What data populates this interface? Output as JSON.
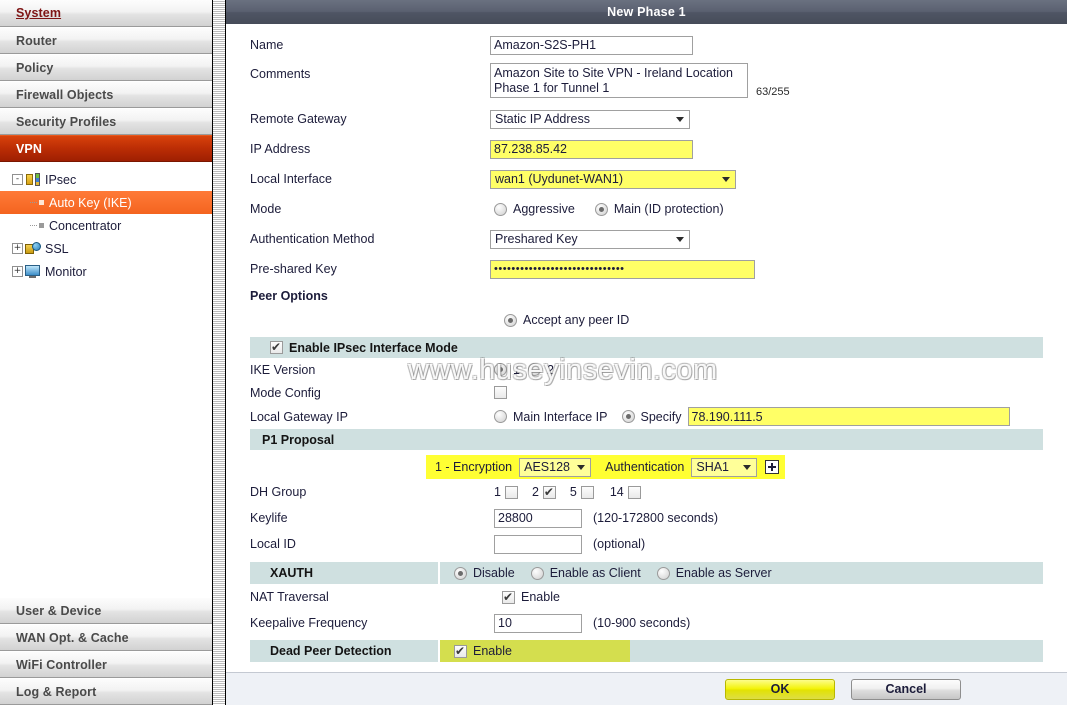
{
  "sidebar": {
    "top_menu": [
      {
        "label": "System",
        "active": false,
        "link": true
      },
      {
        "label": "Router",
        "active": false
      },
      {
        "label": "Policy",
        "active": false
      },
      {
        "label": "Firewall Objects",
        "active": false
      },
      {
        "label": "Security Profiles",
        "active": false
      },
      {
        "label": "VPN",
        "active": true
      }
    ],
    "tree": [
      {
        "label": "IPsec",
        "icon": "ipsec-icon",
        "expander": "-",
        "level": 0,
        "selected": false
      },
      {
        "label": "Auto Key (IKE)",
        "icon": "leaf-icon",
        "level": 1,
        "selected": true
      },
      {
        "label": "Concentrator",
        "icon": "leaf-icon",
        "level": 1,
        "selected": false
      },
      {
        "label": "SSL",
        "icon": "ssl-icon",
        "expander": "+",
        "level": 0,
        "selected": false
      },
      {
        "label": "Monitor",
        "icon": "monitor-icon",
        "expander": "+",
        "level": 0,
        "selected": false
      }
    ],
    "bottom_menu": [
      {
        "label": "User & Device"
      },
      {
        "label": "WAN Opt. & Cache"
      },
      {
        "label": "WiFi Controller"
      },
      {
        "label": "Log & Report"
      }
    ]
  },
  "dialog": {
    "title": "New Phase 1",
    "watermark": "www.huseyinsevin.com",
    "fields": {
      "name_label": "Name",
      "name_value": "Amazon-S2S-PH1",
      "comments_label": "Comments",
      "comments_value": "Amazon Site to Site VPN - Ireland Location Phase 1 for Tunnel 1",
      "comments_counter": "63/255",
      "remote_gateway_label": "Remote Gateway",
      "remote_gateway_value": "Static IP Address",
      "ip_address_label": "IP Address",
      "ip_address_value": "87.238.85.42",
      "local_interface_label": "Local Interface",
      "local_interface_value": "wan1 (Uydunet-WAN1)",
      "mode_label": "Mode",
      "mode_aggressive": "Aggressive",
      "mode_main": "Main (ID protection)",
      "auth_method_label": "Authentication Method",
      "auth_method_value": "Preshared Key",
      "psk_label": "Pre-shared Key",
      "psk_value": "••••••••••••••••••••••••••••••",
      "peer_options_label": "Peer Options",
      "accept_any_peer_id": "Accept any peer ID",
      "enable_ipsec_interface_mode": "Enable IPsec Interface Mode",
      "ike_version_label": "IKE Version",
      "ike_version_1": "1",
      "ike_version_2": "2",
      "mode_config_label": "Mode Config",
      "local_gateway_ip_label": "Local Gateway IP",
      "main_interface_ip": "Main Interface IP",
      "specify": "Specify",
      "local_gateway_ip_value": "78.190.111.5",
      "p1_proposal_label": "P1 Proposal",
      "proposal_index_label": "1 - Encryption",
      "encryption_value": "AES128",
      "authentication_label": "Authentication",
      "authentication_value": "SHA1",
      "add_proposal_icon": "plus-icon",
      "dh_group_label": "DH Group",
      "dh_groups": [
        {
          "label": "1",
          "checked": false
        },
        {
          "label": "2",
          "checked": true
        },
        {
          "label": "5",
          "checked": false
        },
        {
          "label": "14",
          "checked": false
        }
      ],
      "keylife_label": "Keylife",
      "keylife_value": "28800",
      "keylife_hint": "(120-172800 seconds)",
      "local_id_label": "Local ID",
      "local_id_value": "",
      "local_id_hint": "(optional)",
      "xauth_label": "XAUTH",
      "xauth_disable": "Disable",
      "xauth_enable_client": "Enable as Client",
      "xauth_enable_server": "Enable as Server",
      "nat_traversal_label": "NAT Traversal",
      "nat_traversal_enable": "Enable",
      "keepalive_label": "Keepalive Frequency",
      "keepalive_value": "10",
      "keepalive_hint": "(10-900 seconds)",
      "dpd_label": "Dead Peer Detection",
      "dpd_enable": "Enable"
    },
    "buttons": {
      "ok": "OK",
      "cancel": "Cancel"
    }
  },
  "colors": {
    "accent_vpn": "#bb2d05",
    "selected_tree": "#f4641f",
    "section_bar": "#cfe0e0",
    "highlight_yellow": "#ffff66",
    "dpd_highlight": "#d4de4e",
    "titlebar": "#545a68"
  }
}
